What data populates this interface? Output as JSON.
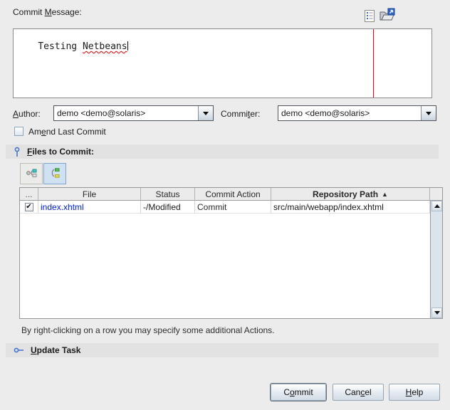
{
  "commit_message": {
    "label": {
      "pre": "Commit ",
      "key": "M",
      "post": "essage:"
    },
    "text_pre": "Testing ",
    "text_misspelled": "Netbeans"
  },
  "authors": {
    "author_label": {
      "pre": "",
      "key": "A",
      "post": "uthor:"
    },
    "author_value": "demo <demo@solaris>",
    "committer_label": {
      "pre": "Commi",
      "key": "t",
      "post": "er:"
    },
    "committer_value": "demo <demo@solaris>"
  },
  "amend": {
    "label": {
      "pre": "Am",
      "key": "e",
      "post": "nd Last Commit"
    },
    "checked": false
  },
  "files_section": {
    "title": {
      "pre": "",
      "key": "F",
      "post": "iles to Commit:"
    },
    "table": {
      "columns": {
        "select": "...",
        "file": "File",
        "status": "Status",
        "action": "Commit Action",
        "path": "Repository Path"
      },
      "sort_indicator": "▲",
      "rows": [
        {
          "check_glyph": "✔",
          "file": "index.xhtml",
          "status": "-/Modified",
          "action": "Commit",
          "path": "src/main/webapp/index.xhtml"
        }
      ]
    },
    "hint": "By right-clicking on a row you may specify some additional Actions."
  },
  "update_task": {
    "title": {
      "pre": "",
      "key": "U",
      "post": "pdate Task"
    }
  },
  "actions": {
    "commit": {
      "pre": "C",
      "key": "o",
      "post": "mmit"
    },
    "cancel": {
      "pre": "Can",
      "key": "c",
      "post": "el"
    },
    "help": {
      "pre": "",
      "key": "H",
      "post": "elp"
    }
  },
  "colors": {
    "margin_line": "#e00000",
    "modified_file_text": "#0021d4",
    "selected_toggle_bg": "#cfe1f3",
    "section_band_bg": "#e2e2e2",
    "dialog_bg": "#ececec"
  }
}
